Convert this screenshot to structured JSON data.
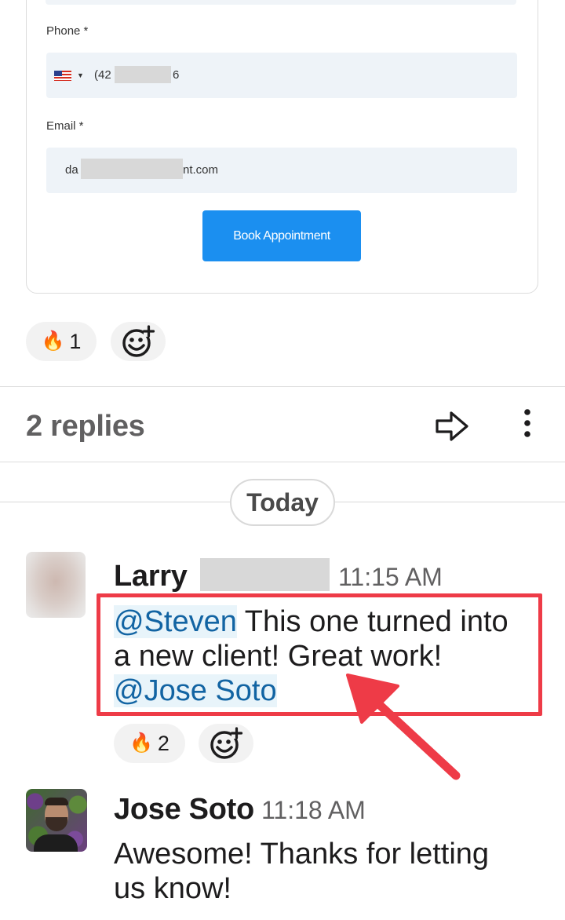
{
  "form": {
    "phone_label": "Phone *",
    "phone_prefix": "(42",
    "phone_suffix": "6",
    "email_label": "Email *",
    "email_prefix": "da",
    "email_suffix": "nt.com",
    "book_button": "Book Appointment"
  },
  "reactions_top": [
    {
      "emoji": "🔥",
      "count": "1"
    }
  ],
  "thread": {
    "replies_label": "2 replies",
    "date_divider": "Today"
  },
  "messages": [
    {
      "sender": "Larry",
      "time": "11:15 AM",
      "mention1": "@Steven",
      "text1": " This one turned into",
      "text2": "a new client! Great work!",
      "mention2": "@Jose Soto",
      "reaction": {
        "emoji": "🔥",
        "count": "2"
      }
    },
    {
      "sender": "Jose Soto",
      "time": "11:18 AM",
      "line1": "Awesome! Thanks for letting",
      "line2": "us know!"
    }
  ],
  "colors": {
    "annotation_red": "#ee3b47",
    "mention_blue": "#1264a3",
    "button_blue": "#1b8ff0"
  }
}
